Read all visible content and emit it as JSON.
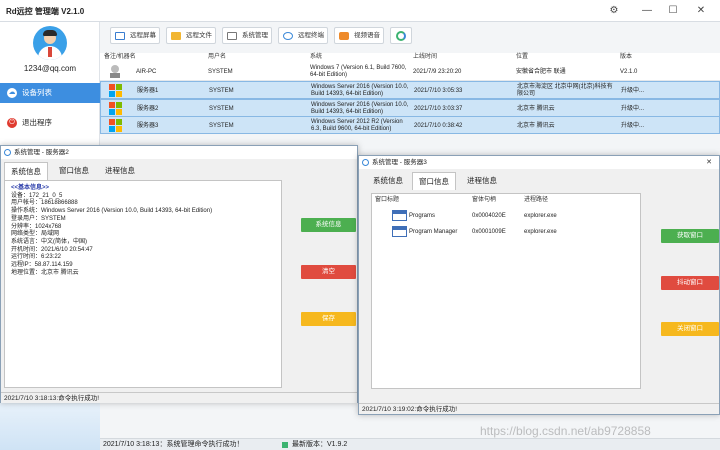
{
  "app": {
    "title": "Rd远控 管理端 V2.1.0",
    "email": "1234@qq.com",
    "sidebar": [
      {
        "label": "设备列表",
        "icon": "cloud-icon",
        "active": true
      },
      {
        "label": "退出程序",
        "icon": "power-icon",
        "active": false
      }
    ],
    "toolbar": [
      "远程屏幕",
      "远程文件",
      "系统管理",
      "远程终端",
      "视频语音"
    ],
    "table": {
      "headers": [
        "备注/机器名",
        "用户名",
        "系统",
        "上线时间",
        "位置",
        "版本"
      ],
      "rows": [
        {
          "name": "AIR-PC",
          "user": "SYSTEM",
          "system": "Windows 7 (Version 6.1, Build 7600, 64-bit Edition)",
          "time": "2021/7/9 23:20:20",
          "location": "安徽省合肥市 联通",
          "version": "V2.1.0",
          "selected": false,
          "icon": "pc-icon"
        },
        {
          "name": "服务器1",
          "user": "SYSTEM",
          "system": "Windows Server 2016 (Version 10.0, Build 14393, 64-bit Edition)",
          "time": "2021/7/10 3:05:33",
          "location": "北京市海淀区 北京中网(北京)科技有限公司",
          "version": "升级中...",
          "selected": true,
          "icon": "windows-icon"
        },
        {
          "name": "服务器2",
          "user": "SYSTEM",
          "system": "Windows Server 2016 (Version 10.0, Build 14393, 64-bit Edition)",
          "time": "2021/7/10 3:03:37",
          "location": "北京市 腾讯云",
          "version": "升级中...",
          "selected": true,
          "icon": "windows-icon"
        },
        {
          "name": "服务器3",
          "user": "SYSTEM",
          "system": "Windows Server 2012 R2 (Version 6.3, Build 9600, 64-bit Edition)",
          "time": "2021/7/10 0:38:42",
          "location": "北京市 腾讯云",
          "version": "升级中...",
          "selected": true,
          "icon": "windows-icon"
        }
      ]
    },
    "status": "2021/7/10 3:18:13：系统管理命令执行成功！",
    "version_label": "最新版本：V1.9.2",
    "watermark": "https://blog.csdn.net/ab9728858"
  },
  "dialog2": {
    "title": "系统管理 - 服务器2",
    "tabs": [
      "系统信息",
      "窗口信息",
      "进程信息"
    ],
    "info": [
      "<<基本信息>>",
      "设备：172_21_0_5",
      "用户帐号：18618866888",
      "操作系统：Windows Server 2016 (Version 10.0, Build 14393, 64-bit Edition)",
      "登录用户：SYSTEM",
      "分辨率：1024x768",
      "网络类型：局域网",
      "系统语言：中文(简体，中国)",
      "开机时间：2021/6/10 20:54:47",
      "运行时间：6:23:22",
      "远程IP：58.87.114.159",
      "地理位置：北京市 腾讯云"
    ],
    "buttons": [
      "系统信息",
      "清空",
      "保存"
    ],
    "status": "2021/7/10 3:18:13:命令执行成功!"
  },
  "dialog3": {
    "title": "系统管理 - 服务器3",
    "tabs": [
      "系统信息",
      "窗口信息",
      "进程信息"
    ],
    "headers": [
      "窗口标题",
      "窗体句柄",
      "进程路径"
    ],
    "rows": [
      {
        "title": "Programs",
        "handle": "0x0004020E",
        "path": "explorer.exe"
      },
      {
        "title": "Program Manager",
        "handle": "0x0001009E",
        "path": "explorer.exe"
      }
    ],
    "buttons": [
      "获取窗口",
      "抖动窗口",
      "关闭窗口"
    ],
    "status": "2021/7/10 3:19:02:命令执行成功!"
  },
  "colors": {
    "accent": "#3d8ee0",
    "green": "#4caf50",
    "red": "#e04b3f",
    "yellow": "#f6b81e",
    "selection": "#cde4f7"
  }
}
